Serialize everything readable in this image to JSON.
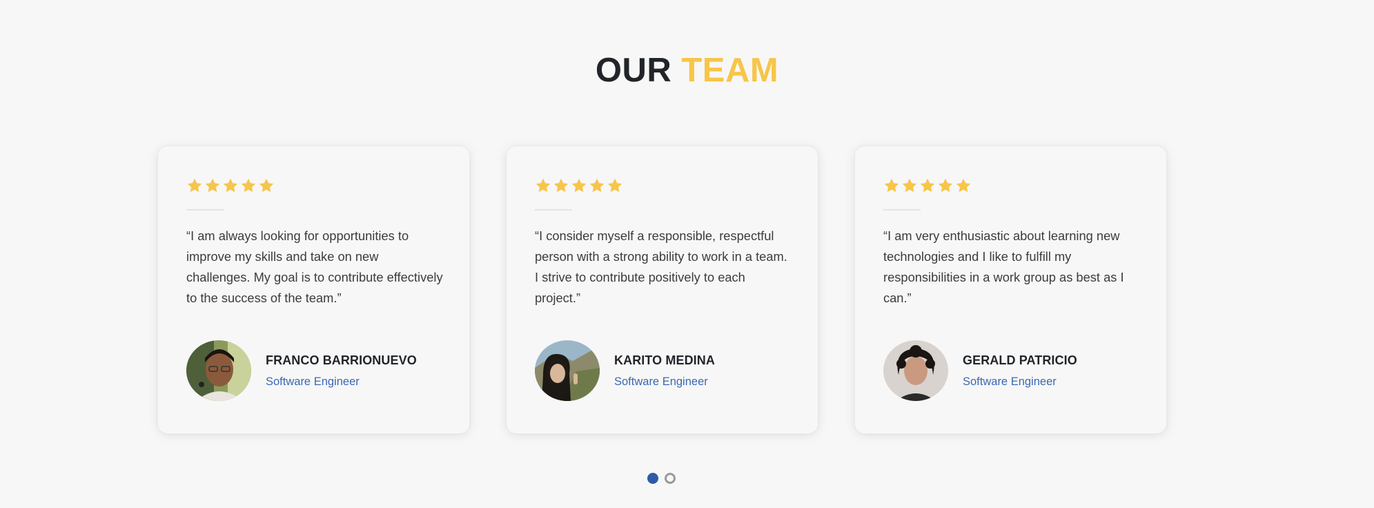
{
  "header": {
    "title_part1": "OUR",
    "title_part2": "TEAM"
  },
  "colors": {
    "accent": "#f7c548",
    "link": "#3b68b5",
    "dot_active": "#2f5aa8"
  },
  "team": [
    {
      "rating": 5,
      "quote": "“I am always looking for opportunities to improve my skills and take on new challenges. My goal is to contribute effectively to the success of the team.”",
      "name": "FRANCO BARRIONUEVO",
      "role": "Software Engineer"
    },
    {
      "rating": 5,
      "quote": "“I consider myself a responsible, respectful person with a strong ability to work in a team. I strive to contribute positively to each project.”",
      "name": "KARITO MEDINA",
      "role": "Software Engineer"
    },
    {
      "rating": 5,
      "quote": "“I am very enthusiastic about learning new technologies and I like to fulfill my responsibilities in a work group as best as I can.”",
      "name": "GERALD PATRICIO",
      "role": "Software Engineer"
    }
  ],
  "icons": {
    "star": "star-icon"
  },
  "pagination": {
    "pages": 2,
    "active_page": 1
  }
}
